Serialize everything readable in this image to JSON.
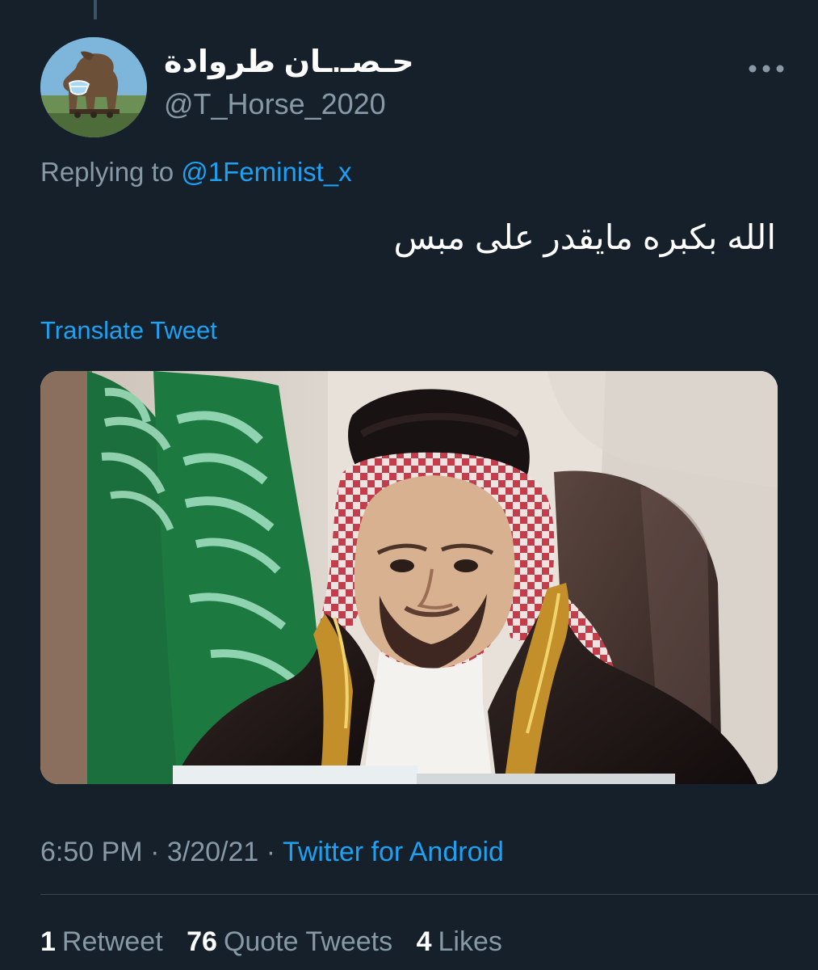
{
  "tweet": {
    "display_name": "حـصـ.ـان طروادة",
    "handle": "@T_Horse_2020",
    "replying_prefix": "Replying to",
    "replying_to": "@1Feminist_x",
    "text": "الله بكبره مايقدر على مبس",
    "translate_label": "Translate Tweet",
    "time": "6:50 PM",
    "date": "3/20/21",
    "source": "Twitter for Android",
    "separator": "·"
  },
  "stats": {
    "retweets": {
      "count": "1",
      "label": "Retweet"
    },
    "quote_tweets": {
      "count": "76",
      "label": "Quote Tweets"
    },
    "likes": {
      "count": "4",
      "label": "Likes"
    }
  },
  "icons": {
    "more": "more-icon",
    "avatar": "trojan-horse-avatar"
  },
  "colors": {
    "background": "#15202b",
    "text": "#ffffff",
    "secondary_text": "#8899a6",
    "link": "#1da1f2",
    "divider": "#38444d"
  }
}
